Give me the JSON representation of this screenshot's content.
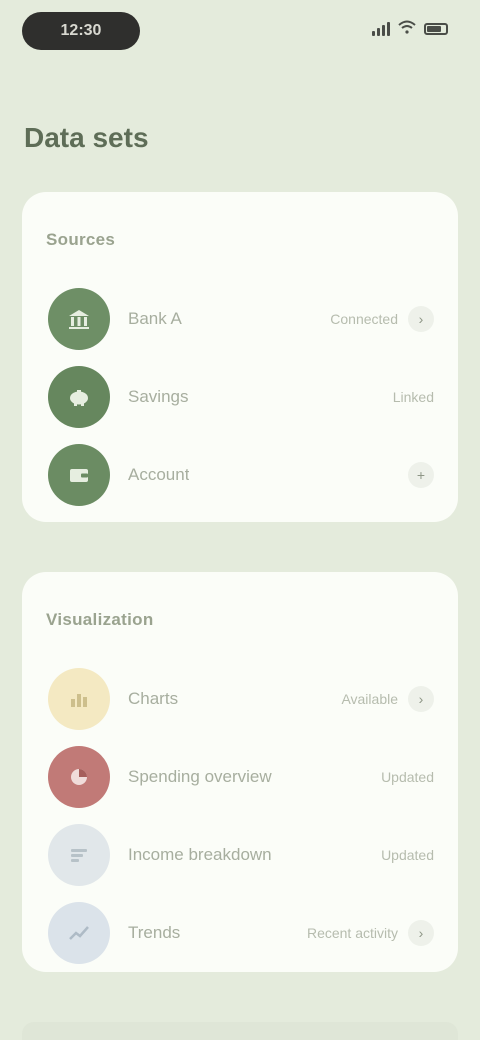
{
  "status_bar": {
    "time": "12:30"
  },
  "page": {
    "title": "Data sets"
  },
  "sources_card": {
    "title": "Sources",
    "items": [
      {
        "label": "Bank A",
        "meta": "Connected",
        "avatar_color": "#6e8f66",
        "icon": "bank-icon"
      },
      {
        "label": "Savings",
        "meta": "Linked",
        "avatar_color": "#66875e",
        "icon": "piggy-bank-icon"
      },
      {
        "label": "Account",
        "meta": "",
        "avatar_color": "#6b8c63",
        "icon": "wallet-icon"
      }
    ]
  },
  "tools_card": {
    "title": "Visualization",
    "items": [
      {
        "label": "Charts",
        "meta": "Available",
        "avatar_color": "#f4e9c2",
        "icon": "chart-icon"
      },
      {
        "label": "Spending overview",
        "meta": "Updated",
        "avatar_color": "#c17a77",
        "icon": "pie-icon"
      },
      {
        "label": "Income breakdown",
        "meta": "Updated",
        "avatar_color": "#e1e7ea",
        "icon": "bars-icon"
      },
      {
        "label": "Trends",
        "meta": "Recent activity",
        "avatar_color": "#dbe3ea",
        "icon": "trend-icon"
      }
    ]
  },
  "colors": {
    "background": "#e4ebdc",
    "card": "#fbfdf8",
    "accent": "#6e8f66"
  }
}
